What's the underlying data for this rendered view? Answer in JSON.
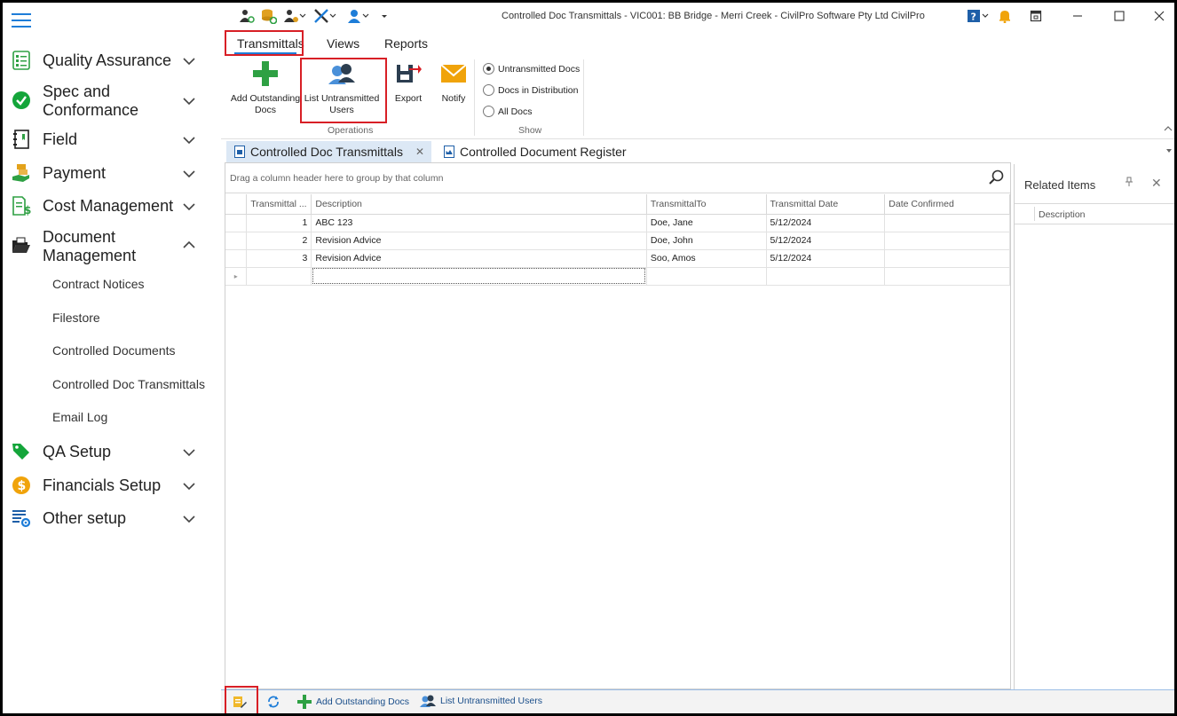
{
  "window": {
    "title": "Controlled Doc Transmittals - VIC001: BB Bridge -  Merri Creek  - CivilPro Software Pty Ltd CivilPro",
    "icons": [
      "help-icon",
      "bell-icon",
      "restore-icon",
      "minimize-icon",
      "maximize-icon",
      "close-icon"
    ]
  },
  "sidebar": {
    "items": [
      {
        "label": "Quality Assurance",
        "icon": "checklist-icon"
      },
      {
        "label": "Spec and",
        "label2": "Conformance",
        "icon": "check-circle-icon"
      },
      {
        "label": "Field",
        "icon": "notebook-icon"
      },
      {
        "label": "Payment",
        "icon": "payment-hand-icon"
      },
      {
        "label": "Cost Management",
        "icon": "cost-document-icon"
      },
      {
        "label": "Document",
        "label2": "Management",
        "icon": "folder-open-icon"
      },
      {
        "label": "QA Setup",
        "icon": "tag-icon"
      },
      {
        "label": "Financials Setup",
        "icon": "dollar-coin-icon"
      },
      {
        "label": "Other setup",
        "icon": "settings-list-icon"
      }
    ],
    "sub_items": [
      "Contract Notices",
      "Filestore",
      "Controlled Documents",
      "Controlled Doc Transmittals",
      "Email Log"
    ]
  },
  "ribbon": {
    "tabs": [
      "Transmittals",
      "Views",
      "Reports"
    ],
    "buttons": {
      "add_outstanding": "Add Outstanding",
      "add_outstanding2": "Docs",
      "list_untransmitted": "List Untransmitted",
      "list_untransmitted2": "Users",
      "export": "Export",
      "notify": "Notify"
    },
    "groups": {
      "operations": "Operations",
      "show": "Show"
    },
    "show_options": [
      {
        "label": "Untransmitted Docs",
        "selected": true
      },
      {
        "label": "Docs in Distribution",
        "selected": false
      },
      {
        "label": "All Docs",
        "selected": false
      }
    ]
  },
  "doc_tabs": [
    "Controlled Doc Transmittals",
    "Controlled Document Register"
  ],
  "grid": {
    "group_hint": "Drag a column header here to group by that column",
    "columns": [
      "Transmittal ...",
      "Description",
      "TransmittalTo",
      "Transmittal Date",
      "Date Confirmed"
    ],
    "rows": [
      {
        "id": "1",
        "description": "ABC 123",
        "to": "Doe, Jane",
        "date": "5/12/2024",
        "confirmed": ""
      },
      {
        "id": "2",
        "description": "Revision Advice",
        "to": "Doe, John",
        "date": "5/12/2024",
        "confirmed": ""
      },
      {
        "id": "3",
        "description": "Revision Advice",
        "to": "Soo, Amos",
        "date": "5/12/2024",
        "confirmed": ""
      }
    ]
  },
  "related": {
    "title": "Related Items",
    "column": "Description"
  },
  "bottombar": {
    "add_outstanding": "Add Outstanding Docs",
    "list_untransmitted": "List Untransmitted Users"
  },
  "colors": {
    "accent": "#1e7dd8",
    "highlight": "#d81f26",
    "green": "#2ea043",
    "orange": "#f0a30a"
  }
}
